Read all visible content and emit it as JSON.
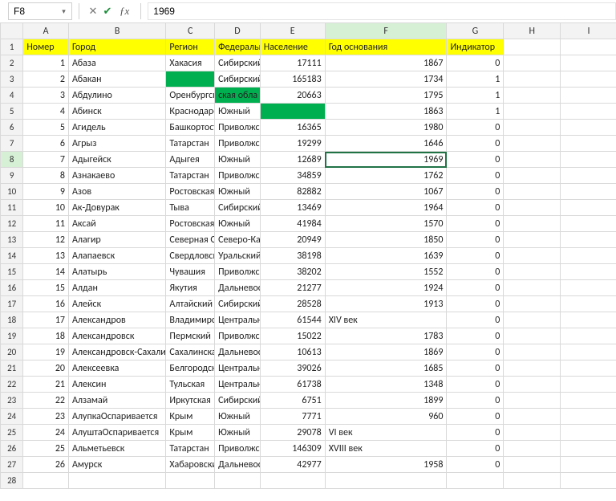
{
  "nameBox": "F8",
  "formula": "1969",
  "columns": [
    "A",
    "B",
    "C",
    "D",
    "E",
    "F",
    "G",
    "H",
    "I"
  ],
  "selectedCell": {
    "row": 8,
    "col": "F"
  },
  "headerRow": {
    "A": "Номер",
    "B": "Город",
    "C": "Регион",
    "D": "Федеральный округ",
    "E": "Население",
    "F": "Год основания",
    "G": "Индикатор"
  },
  "rows": [
    {
      "n": 2,
      "A": 1,
      "B": "Абаза",
      "C": "Хакасия",
      "D": "Сибирский",
      "E": 17111,
      "F": 1867,
      "G": 0
    },
    {
      "n": 3,
      "A": 2,
      "B": "Абакан",
      "C": "",
      "Cgreen": true,
      "D": "Сибирский",
      "E": 165183,
      "F": 1734,
      "G": 1
    },
    {
      "n": 4,
      "A": 3,
      "B": "Абдулино",
      "C": "Оренбургская",
      "D": "ская обла",
      "Dgreen": true,
      "E": 20663,
      "F": 1795,
      "G": 1
    },
    {
      "n": 5,
      "A": 4,
      "B": "Абинск",
      "C": "Краснодарский",
      "D": "Южный",
      "E": "",
      "Egreen": true,
      "F": 1863,
      "G": 1
    },
    {
      "n": 6,
      "A": 5,
      "B": "Агидель",
      "C": "Башкортостан",
      "D": "Приволжский",
      "E": 16365,
      "F": 1980,
      "G": 0
    },
    {
      "n": 7,
      "A": 6,
      "B": "Агрыз",
      "C": "Татарстан",
      "D": "Приволжский",
      "E": 19299,
      "F": 1646,
      "G": 0
    },
    {
      "n": 8,
      "A": 7,
      "B": "Адыгейск",
      "C": "Адыгея",
      "D": "Южный",
      "E": 12689,
      "F": 1969,
      "G": 0
    },
    {
      "n": 9,
      "A": 8,
      "B": "Азнакаево",
      "C": "Татарстан",
      "D": "Приволжский",
      "E": 34859,
      "F": 1762,
      "G": 0
    },
    {
      "n": 10,
      "A": 9,
      "B": "Азов",
      "C": "Ростовская",
      "D": "Южный",
      "E": 82882,
      "F": 1067,
      "G": 0
    },
    {
      "n": 11,
      "A": 10,
      "B": "Ак-Довурак",
      "C": "Тыва",
      "D": "Сибирский",
      "E": 13469,
      "F": 1964,
      "G": 0
    },
    {
      "n": 12,
      "A": 11,
      "B": "Аксай",
      "C": "Ростовская",
      "D": "Южный",
      "E": 41984,
      "F": 1570,
      "G": 0
    },
    {
      "n": 13,
      "A": 12,
      "B": "Алагир",
      "C": "Северная Осетия",
      "D": "Северо-Кавказский",
      "E": 20949,
      "F": 1850,
      "G": 0
    },
    {
      "n": 14,
      "A": 13,
      "B": "Алапаевск",
      "C": "Свердловская",
      "D": "Уральский",
      "E": 38198,
      "F": 1639,
      "G": 0
    },
    {
      "n": 15,
      "A": 14,
      "B": "Алатырь",
      "C": "Чувашия",
      "D": "Приволжский",
      "E": 38202,
      "F": 1552,
      "G": 0
    },
    {
      "n": 16,
      "A": 15,
      "B": "Алдан",
      "C": "Якутия",
      "D": "Дальневосточный",
      "E": 21277,
      "F": 1924,
      "G": 0
    },
    {
      "n": 17,
      "A": 16,
      "B": "Алейск",
      "C": "Алтайский",
      "D": "Сибирский",
      "E": 28528,
      "F": 1913,
      "G": 0
    },
    {
      "n": 18,
      "A": 17,
      "B": "Александров",
      "C": "Владимирская",
      "D": "Центральный",
      "E": 61544,
      "F": "XIV век",
      "Ftxt": true,
      "G": 0
    },
    {
      "n": 19,
      "A": 18,
      "B": "Александровск",
      "C": "Пермский",
      "D": "Приволжский",
      "E": 15022,
      "F": 1783,
      "G": 0
    },
    {
      "n": 20,
      "A": 19,
      "B": "Александровск-Сахалинский",
      "C": "Сахалинская",
      "D": "Дальневосточный",
      "E": 10613,
      "F": 1869,
      "G": 0
    },
    {
      "n": 21,
      "A": 20,
      "B": "Алексеевка",
      "C": "Белгородская",
      "D": "Центральный",
      "E": 39026,
      "F": 1685,
      "G": 0
    },
    {
      "n": 22,
      "A": 21,
      "B": "Алексин",
      "C": "Тульская",
      "D": "Центральный",
      "E": 61738,
      "F": 1348,
      "G": 0
    },
    {
      "n": 23,
      "A": 22,
      "B": "Алзамай",
      "C": "Иркутская",
      "D": "Сибирский",
      "E": 6751,
      "F": 1899,
      "G": 0
    },
    {
      "n": 24,
      "A": 23,
      "B": "АлупкаОспаривается",
      "C": "Крым",
      "D": "Южный",
      "E": 7771,
      "F": 960,
      "G": 0
    },
    {
      "n": 25,
      "A": 24,
      "B": "АлуштаОспаривается",
      "C": "Крым",
      "D": "Южный",
      "E": 29078,
      "F": "VI век",
      "Ftxt": true,
      "G": 0
    },
    {
      "n": 26,
      "A": 25,
      "B": "Альметьевск",
      "C": "Татарстан",
      "D": "Приволжский",
      "E": 146309,
      "F": "XVIII век",
      "Ftxt": true,
      "G": 0
    },
    {
      "n": 27,
      "A": 26,
      "B": "Амурск",
      "C": "Хабаровский",
      "D": "Дальневосточный",
      "E": 42977,
      "F": 1958,
      "G": 0
    }
  ],
  "emptyRows": [
    28
  ]
}
